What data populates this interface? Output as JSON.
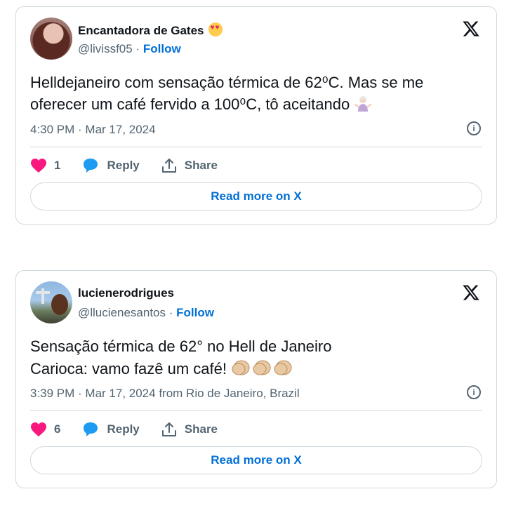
{
  "tweets": [
    {
      "display_name": "Encantadora de Gates",
      "handle": "@livissf05",
      "follow_label": "Follow",
      "separator": "·",
      "text_line1": "Helldejaneiro com sensação térmica de 62⁰C. Mas se me",
      "text_line2": "oferecer um café fervido a 100⁰C, tô aceitando",
      "meta": "4:30 PM · Mar 17, 2024",
      "likes": "1",
      "reply_label": "Reply",
      "share_label": "Share",
      "read_more_label": "Read more on X",
      "name_emoji": "heart-eyes-icon",
      "text_emoji": "person-shrugging-icon"
    },
    {
      "display_name": "lucienerodrigues",
      "handle": "@llucienesantos",
      "follow_label": "Follow",
      "separator": "·",
      "text_line1": "Sensação térmica de 62° no Hell de Janeiro",
      "text_line2": "Carioca: vamo fazê um café!",
      "meta": "3:39 PM · Mar 17, 2024 from Rio de Janeiro, Brazil",
      "likes": "6",
      "reply_label": "Reply",
      "share_label": "Share",
      "read_more_label": "Read more on X",
      "text_emoji": "clapping-hands-icon"
    }
  ],
  "colors": {
    "link": "#006fd6",
    "like": "#f91880",
    "reply": "#1d9bf0",
    "muted": "#536471",
    "border": "#cfd9de"
  }
}
